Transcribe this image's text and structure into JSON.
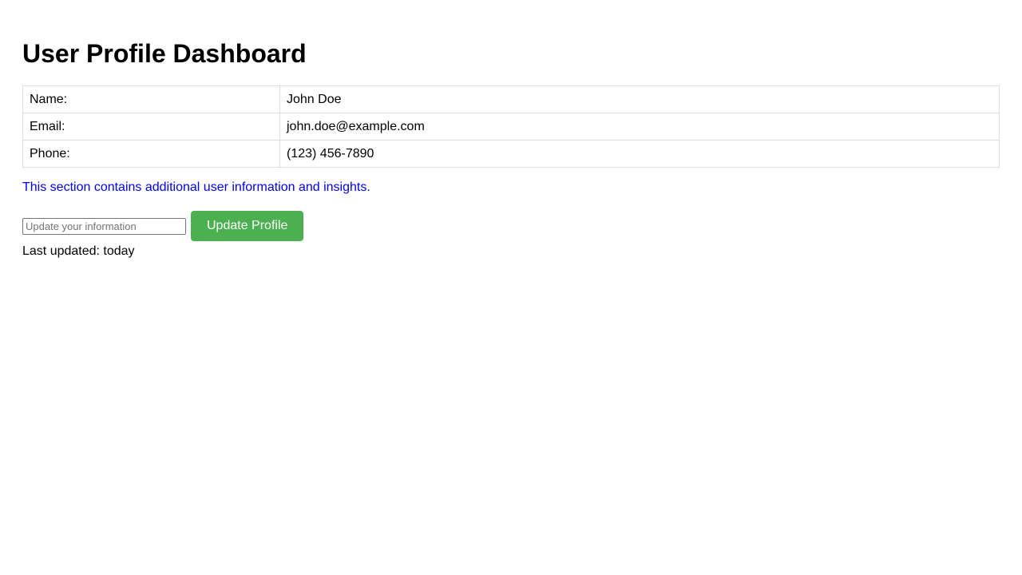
{
  "page": {
    "title": "User Profile Dashboard"
  },
  "profile": {
    "rows": [
      {
        "label": "Name:",
        "value": "John Doe"
      },
      {
        "label": "Email:",
        "value": "john.doe@example.com"
      },
      {
        "label": "Phone:",
        "value": "(123) 456-7890"
      }
    ]
  },
  "info": {
    "text": "This section contains additional user information and insights."
  },
  "update": {
    "input_value": "",
    "input_placeholder": "Update your information",
    "button_label": "Update Profile"
  },
  "status": {
    "last_updated": "Last updated: today"
  },
  "colors": {
    "accent_button": "#4caf50",
    "info_text": "#0000ee",
    "table_border": "#dddddd"
  }
}
